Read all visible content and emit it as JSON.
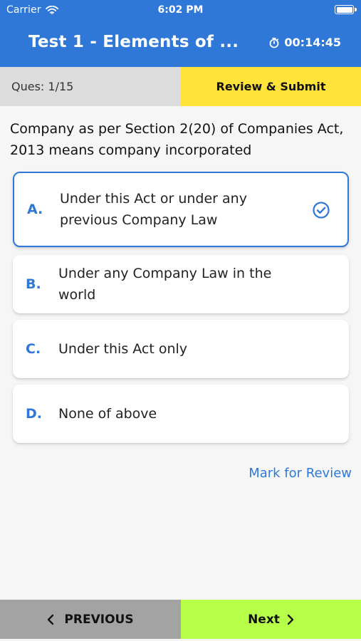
{
  "status_bar": {
    "carrier": "Carrier",
    "time": "6:02 PM"
  },
  "header": {
    "title": "Test 1 - Elements of ...",
    "timer": "00:14:45"
  },
  "question_info": {
    "count": "Ques: 1/15",
    "review_submit": "Review & Submit"
  },
  "question": {
    "text": "Company as per Section 2(20) of Companies Act, 2013 means company incorporated"
  },
  "options": [
    {
      "letter": "A.",
      "text": "Under this Act or under any previous Company Law",
      "selected": true
    },
    {
      "letter": "B.",
      "text": "Under any Company Law in the world",
      "selected": false
    },
    {
      "letter": "C.",
      "text": "Under this Act only",
      "selected": false
    },
    {
      "letter": "D.",
      "text": "None of above",
      "selected": false
    }
  ],
  "mark_review": "Mark for Review",
  "navigation": {
    "previous": "PREVIOUS",
    "next": "Next"
  },
  "icons": {
    "wifi": "wifi-icon",
    "battery": "battery-icon",
    "timer": "timer-icon",
    "check": "check-circle-icon",
    "previous": "chevron-left-icon",
    "next": "chevron-right-icon"
  },
  "colors": {
    "primary": "#2f78d8",
    "review_submit_bg": "#ffe23a",
    "next_bg": "#b8ff4a",
    "previous_bg": "#a3a3a3"
  }
}
